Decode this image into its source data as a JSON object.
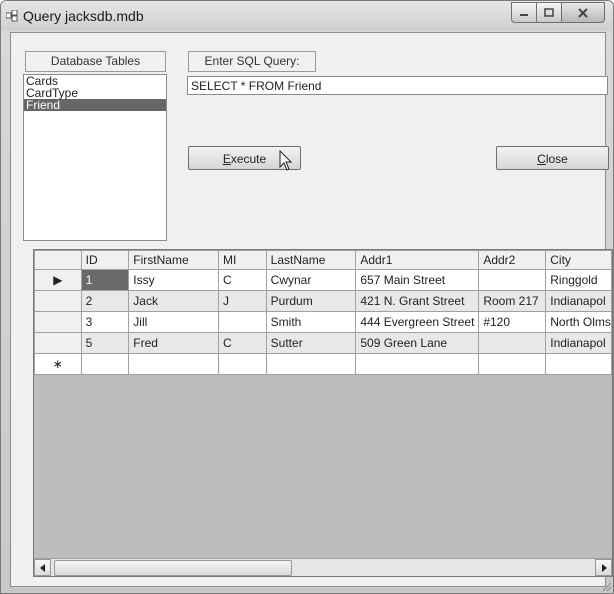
{
  "window": {
    "title": "Query jacksdb.mdb"
  },
  "panel": {
    "tables_label": "Database Tables",
    "tables": [
      "Cards",
      "CardType",
      "Friend"
    ],
    "selected_table": "Friend",
    "query_label": "Enter SQL Query:",
    "query_value": "SELECT * FROM Friend",
    "execute_mnemonic": "E",
    "execute_rest": "xecute",
    "close_mnemonic": "C",
    "close_rest": "lose"
  },
  "grid": {
    "columns": [
      "ID",
      "FirstName",
      "MI",
      "LastName",
      "Addr1",
      "Addr2",
      "City"
    ],
    "rows": [
      [
        "1",
        "Issy",
        "C",
        "Cwynar",
        "657 Main Street",
        "",
        "Ringgold"
      ],
      [
        "2",
        "Jack",
        "J",
        "Purdum",
        "421 N. Grant Street",
        "Room 217",
        "Indianapol"
      ],
      [
        "3",
        "Jill",
        "",
        "Smith",
        "444 Evergreen Street",
        "#120",
        "North Olms"
      ],
      [
        "5",
        "Fred",
        "C",
        "Sutter",
        "509 Green Lane",
        "",
        "Indianapol"
      ]
    ],
    "current_row_marker": "▶",
    "new_row_marker": "∗"
  }
}
